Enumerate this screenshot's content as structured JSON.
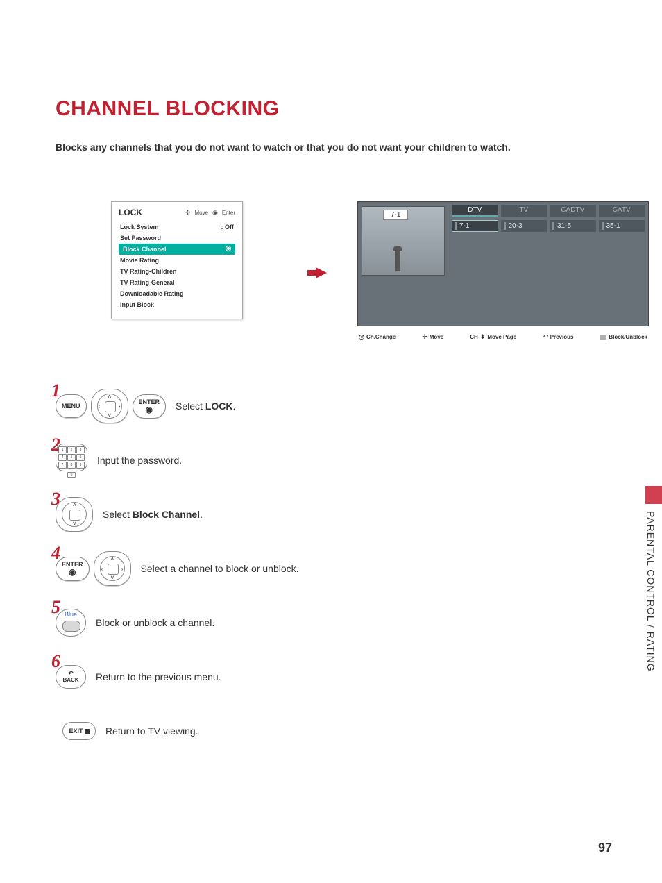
{
  "title": "CHANNEL BLOCKING",
  "intro": "Blocks any channels that you do not want to watch or that you do not want your children to watch.",
  "lock_panel": {
    "title": "LOCK",
    "hint_move": "Move",
    "hint_enter": "Enter",
    "items": [
      {
        "label": "Lock System",
        "value": ": Off"
      },
      {
        "label": "Set Password",
        "value": ""
      },
      {
        "label": "Block Channel",
        "value": "",
        "selected": true
      },
      {
        "label": "Movie Rating",
        "value": ""
      },
      {
        "label": "TV Rating-Children",
        "value": ""
      },
      {
        "label": "TV Rating-General",
        "value": ""
      },
      {
        "label": "Downloadable Rating",
        "value": ""
      },
      {
        "label": "Input Block",
        "value": ""
      }
    ]
  },
  "tv_panel": {
    "preview_ch": "7-1",
    "tabs": [
      "DTV",
      "TV",
      "CADTV",
      "CATV"
    ],
    "tab_active": 0,
    "channels": [
      "7-1",
      "20-3",
      "31-5",
      "35-1"
    ],
    "ch_selected": 0,
    "legend": {
      "chchange": "Ch.Change",
      "move": "Move",
      "movepage": "Move Page",
      "chlabel": "CH",
      "previous": "Previous",
      "block": "Block/Unblock"
    }
  },
  "steps": {
    "s1_pre": "Select ",
    "s1_b": "LOCK",
    "s1_post": ".",
    "s2": "Input the password.",
    "s3_pre": "Select ",
    "s3_b": "Block Channel",
    "s3_post": ".",
    "s4": "Select a channel to block or unblock.",
    "s5": "Block or unblock a channel.",
    "s6": "Return to the previous menu.",
    "exit": "Return to TV viewing."
  },
  "buttons": {
    "menu": "MENU",
    "enter": "ENTER",
    "blue": "Blue",
    "back": "BACK",
    "exit": "EXIT"
  },
  "side_section": "PARENTAL CONTROL / RATING",
  "page_number": "97"
}
